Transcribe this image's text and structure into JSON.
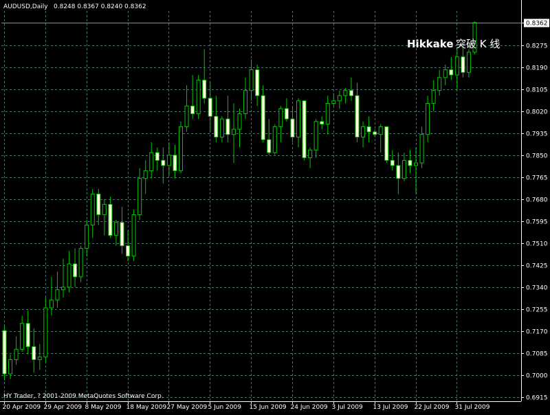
{
  "header": {
    "symbol": "AUDUSD,Daily",
    "ohlc": "0.8248 0.8367 0.8240 0.8362"
  },
  "footer": {
    "copyright": "HY Trader, ? 2001-2009 MetaQuotes Software Corp."
  },
  "annotation": {
    "latin": "Hikkake",
    "cjk": "突破 K 线",
    "latin_color": "#ff00ff",
    "cjk_color": "#c000c0"
  },
  "current_price": {
    "label": "0.8362",
    "value": 0.8362
  },
  "colors": {
    "background": "#000000",
    "grid": "#4f6f6f",
    "candle_wick": "#00c800",
    "bull_body": "#000000",
    "bear_body": "#ffffe0",
    "axis": "#ffffff",
    "price_line": "#7f8f9f"
  },
  "chart_data": {
    "type": "candlestick",
    "symbol": "AUDUSD",
    "timeframe": "Daily",
    "y_ticks": [
      "0.8362",
      "0.8275",
      "0.8190",
      "0.8105",
      "0.8020",
      "0.7935",
      "0.7850",
      "0.7765",
      "0.7680",
      "0.7595",
      "0.7510",
      "0.7425",
      "0.7340",
      "0.7255",
      "0.7170",
      "0.7085",
      "0.7000",
      "0.6915"
    ],
    "ylim": [
      0.6915,
      0.8362
    ],
    "x_labels": [
      "20 Apr 2009",
      "29 Apr 2009",
      "8 May 2009",
      "18 May 2009",
      "27 May 2009",
      "5 Jun 2009",
      "15 Jun 2009",
      "24 Jun 2009",
      "3 Jul 2009",
      "13 Jul 2009",
      "22 Jul 2009",
      "31 Jul 2009"
    ],
    "x_label_index": [
      0,
      7,
      14,
      21,
      28,
      35,
      42,
      49,
      56,
      63,
      70,
      77
    ],
    "grid": true,
    "candles": [
      {
        "d": "2009-04-20",
        "o": 0.7172,
        "h": 0.719,
        "l": 0.698,
        "c": 0.7005
      },
      {
        "d": "2009-04-21",
        "o": 0.7005,
        "h": 0.708,
        "l": 0.6985,
        "c": 0.706
      },
      {
        "d": "2009-04-22",
        "o": 0.706,
        "h": 0.715,
        "l": 0.704,
        "c": 0.71
      },
      {
        "d": "2009-04-23",
        "o": 0.71,
        "h": 0.723,
        "l": 0.709,
        "c": 0.72
      },
      {
        "d": "2009-04-24",
        "o": 0.72,
        "h": 0.725,
        "l": 0.708,
        "c": 0.711
      },
      {
        "d": "2009-04-27",
        "o": 0.711,
        "h": 0.718,
        "l": 0.701,
        "c": 0.706
      },
      {
        "d": "2009-04-28",
        "o": 0.706,
        "h": 0.712,
        "l": 0.702,
        "c": 0.707
      },
      {
        "d": "2009-04-29",
        "o": 0.707,
        "h": 0.73,
        "l": 0.705,
        "c": 0.726
      },
      {
        "d": "2009-04-30",
        "o": 0.726,
        "h": 0.738,
        "l": 0.723,
        "c": 0.729
      },
      {
        "d": "2009-05-01",
        "o": 0.729,
        "h": 0.74,
        "l": 0.726,
        "c": 0.733
      },
      {
        "d": "2009-05-04",
        "o": 0.733,
        "h": 0.745,
        "l": 0.73,
        "c": 0.734
      },
      {
        "d": "2009-05-05",
        "o": 0.734,
        "h": 0.748,
        "l": 0.732,
        "c": 0.743
      },
      {
        "d": "2009-05-06",
        "o": 0.743,
        "h": 0.749,
        "l": 0.734,
        "c": 0.738
      },
      {
        "d": "2009-05-07",
        "o": 0.738,
        "h": 0.75,
        "l": 0.736,
        "c": 0.749
      },
      {
        "d": "2009-05-08",
        "o": 0.749,
        "h": 0.76,
        "l": 0.746,
        "c": 0.758
      },
      {
        "d": "2009-05-11",
        "o": 0.758,
        "h": 0.772,
        "l": 0.753,
        "c": 0.77
      },
      {
        "d": "2009-05-12",
        "o": 0.77,
        "h": 0.772,
        "l": 0.758,
        "c": 0.762
      },
      {
        "d": "2009-05-13",
        "o": 0.762,
        "h": 0.768,
        "l": 0.754,
        "c": 0.766
      },
      {
        "d": "2009-05-14",
        "o": 0.766,
        "h": 0.769,
        "l": 0.753,
        "c": 0.754
      },
      {
        "d": "2009-05-15",
        "o": 0.754,
        "h": 0.76,
        "l": 0.75,
        "c": 0.759
      },
      {
        "d": "2009-05-18",
        "o": 0.759,
        "h": 0.765,
        "l": 0.747,
        "c": 0.75
      },
      {
        "d": "2009-05-19",
        "o": 0.75,
        "h": 0.756,
        "l": 0.744,
        "c": 0.746
      },
      {
        "d": "2009-05-20",
        "o": 0.746,
        "h": 0.764,
        "l": 0.744,
        "c": 0.762
      },
      {
        "d": "2009-05-21",
        "o": 0.762,
        "h": 0.78,
        "l": 0.76,
        "c": 0.776
      },
      {
        "d": "2009-05-22",
        "o": 0.776,
        "h": 0.783,
        "l": 0.77,
        "c": 0.779
      },
      {
        "d": "2009-05-25",
        "o": 0.779,
        "h": 0.79,
        "l": 0.776,
        "c": 0.786
      },
      {
        "d": "2009-05-26",
        "o": 0.786,
        "h": 0.788,
        "l": 0.779,
        "c": 0.783
      },
      {
        "d": "2009-05-27",
        "o": 0.783,
        "h": 0.788,
        "l": 0.774,
        "c": 0.781
      },
      {
        "d": "2009-05-28",
        "o": 0.781,
        "h": 0.79,
        "l": 0.777,
        "c": 0.785
      },
      {
        "d": "2009-05-29",
        "o": 0.785,
        "h": 0.789,
        "l": 0.776,
        "c": 0.779
      },
      {
        "d": "2009-06-01",
        "o": 0.779,
        "h": 0.798,
        "l": 0.778,
        "c": 0.796
      },
      {
        "d": "2009-06-02",
        "o": 0.796,
        "h": 0.812,
        "l": 0.794,
        "c": 0.804
      },
      {
        "d": "2009-06-03",
        "o": 0.804,
        "h": 0.816,
        "l": 0.799,
        "c": 0.801
      },
      {
        "d": "2009-06-04",
        "o": 0.801,
        "h": 0.816,
        "l": 0.799,
        "c": 0.814
      },
      {
        "d": "2009-06-05",
        "o": 0.814,
        "h": 0.826,
        "l": 0.805,
        "c": 0.807
      },
      {
        "d": "2009-06-08",
        "o": 0.807,
        "h": 0.813,
        "l": 0.794,
        "c": 0.8
      },
      {
        "d": "2009-06-09",
        "o": 0.8,
        "h": 0.808,
        "l": 0.79,
        "c": 0.792
      },
      {
        "d": "2009-06-10",
        "o": 0.792,
        "h": 0.8,
        "l": 0.79,
        "c": 0.799
      },
      {
        "d": "2009-06-11",
        "o": 0.799,
        "h": 0.808,
        "l": 0.79,
        "c": 0.793
      },
      {
        "d": "2009-06-12",
        "o": 0.793,
        "h": 0.805,
        "l": 0.782,
        "c": 0.795
      },
      {
        "d": "2009-06-15",
        "o": 0.795,
        "h": 0.803,
        "l": 0.788,
        "c": 0.801
      },
      {
        "d": "2009-06-16",
        "o": 0.801,
        "h": 0.815,
        "l": 0.799,
        "c": 0.81
      },
      {
        "d": "2009-06-17",
        "o": 0.81,
        "h": 0.822,
        "l": 0.806,
        "c": 0.818
      },
      {
        "d": "2009-06-18",
        "o": 0.818,
        "h": 0.82,
        "l": 0.804,
        "c": 0.808
      },
      {
        "d": "2009-06-19",
        "o": 0.808,
        "h": 0.812,
        "l": 0.79,
        "c": 0.791
      },
      {
        "d": "2009-06-22",
        "o": 0.791,
        "h": 0.799,
        "l": 0.785,
        "c": 0.786
      },
      {
        "d": "2009-06-23",
        "o": 0.786,
        "h": 0.797,
        "l": 0.785,
        "c": 0.796
      },
      {
        "d": "2009-06-24",
        "o": 0.796,
        "h": 0.804,
        "l": 0.79,
        "c": 0.803
      },
      {
        "d": "2009-06-25",
        "o": 0.803,
        "h": 0.807,
        "l": 0.798,
        "c": 0.799
      },
      {
        "d": "2009-06-26",
        "o": 0.799,
        "h": 0.804,
        "l": 0.79,
        "c": 0.792
      },
      {
        "d": "2009-06-29",
        "o": 0.792,
        "h": 0.807,
        "l": 0.788,
        "c": 0.806
      },
      {
        "d": "2009-06-30",
        "o": 0.806,
        "h": 0.806,
        "l": 0.783,
        "c": 0.784
      },
      {
        "d": "2009-07-01",
        "o": 0.784,
        "h": 0.788,
        "l": 0.78,
        "c": 0.787
      },
      {
        "d": "2009-07-02",
        "o": 0.787,
        "h": 0.799,
        "l": 0.784,
        "c": 0.798
      },
      {
        "d": "2009-07-03",
        "o": 0.798,
        "h": 0.8,
        "l": 0.795,
        "c": 0.797
      },
      {
        "d": "2009-07-06",
        "o": 0.797,
        "h": 0.808,
        "l": 0.793,
        "c": 0.805
      },
      {
        "d": "2009-07-07",
        "o": 0.805,
        "h": 0.809,
        "l": 0.804,
        "c": 0.806
      },
      {
        "d": "2009-07-08",
        "o": 0.806,
        "h": 0.81,
        "l": 0.803,
        "c": 0.808
      },
      {
        "d": "2009-07-09",
        "o": 0.808,
        "h": 0.811,
        "l": 0.805,
        "c": 0.81
      },
      {
        "d": "2009-07-10",
        "o": 0.81,
        "h": 0.815,
        "l": 0.806,
        "c": 0.808
      },
      {
        "d": "2009-07-13",
        "o": 0.808,
        "h": 0.813,
        "l": 0.79,
        "c": 0.792
      },
      {
        "d": "2009-07-14",
        "o": 0.792,
        "h": 0.798,
        "l": 0.788,
        "c": 0.796
      },
      {
        "d": "2009-07-15",
        "o": 0.796,
        "h": 0.8,
        "l": 0.79,
        "c": 0.794
      },
      {
        "d": "2009-07-16",
        "o": 0.794,
        "h": 0.795,
        "l": 0.792,
        "c": 0.793
      },
      {
        "d": "2009-07-17",
        "o": 0.793,
        "h": 0.797,
        "l": 0.786,
        "c": 0.796
      },
      {
        "d": "2009-07-20",
        "o": 0.796,
        "h": 0.796,
        "l": 0.782,
        "c": 0.783
      },
      {
        "d": "2009-07-21",
        "o": 0.783,
        "h": 0.787,
        "l": 0.779,
        "c": 0.781
      },
      {
        "d": "2009-07-22",
        "o": 0.781,
        "h": 0.786,
        "l": 0.77,
        "c": 0.776
      },
      {
        "d": "2009-07-23",
        "o": 0.776,
        "h": 0.786,
        "l": 0.775,
        "c": 0.783
      },
      {
        "d": "2009-07-24",
        "o": 0.783,
        "h": 0.787,
        "l": 0.778,
        "c": 0.781
      },
      {
        "d": "2009-07-27",
        "o": 0.781,
        "h": 0.788,
        "l": 0.77,
        "c": 0.782
      },
      {
        "d": "2009-07-28",
        "o": 0.782,
        "h": 0.796,
        "l": 0.78,
        "c": 0.793
      },
      {
        "d": "2009-07-29",
        "o": 0.793,
        "h": 0.808,
        "l": 0.79,
        "c": 0.805
      },
      {
        "d": "2009-07-30",
        "o": 0.805,
        "h": 0.814,
        "l": 0.802,
        "c": 0.81
      },
      {
        "d": "2009-07-31",
        "o": 0.81,
        "h": 0.818,
        "l": 0.808,
        "c": 0.815
      },
      {
        "d": "2009-08-03",
        "o": 0.815,
        "h": 0.82,
        "l": 0.812,
        "c": 0.818
      },
      {
        "d": "2009-08-04",
        "o": 0.818,
        "h": 0.823,
        "l": 0.814,
        "c": 0.816
      },
      {
        "d": "2009-08-05",
        "o": 0.816,
        "h": 0.826,
        "l": 0.81,
        "c": 0.823
      },
      {
        "d": "2009-08-06",
        "o": 0.823,
        "h": 0.828,
        "l": 0.815,
        "c": 0.817
      },
      {
        "d": "2009-08-07",
        "o": 0.817,
        "h": 0.826,
        "l": 0.815,
        "c": 0.8248
      },
      {
        "d": "2009-08-10",
        "o": 0.8248,
        "h": 0.8367,
        "l": 0.824,
        "c": 0.8362
      }
    ]
  }
}
